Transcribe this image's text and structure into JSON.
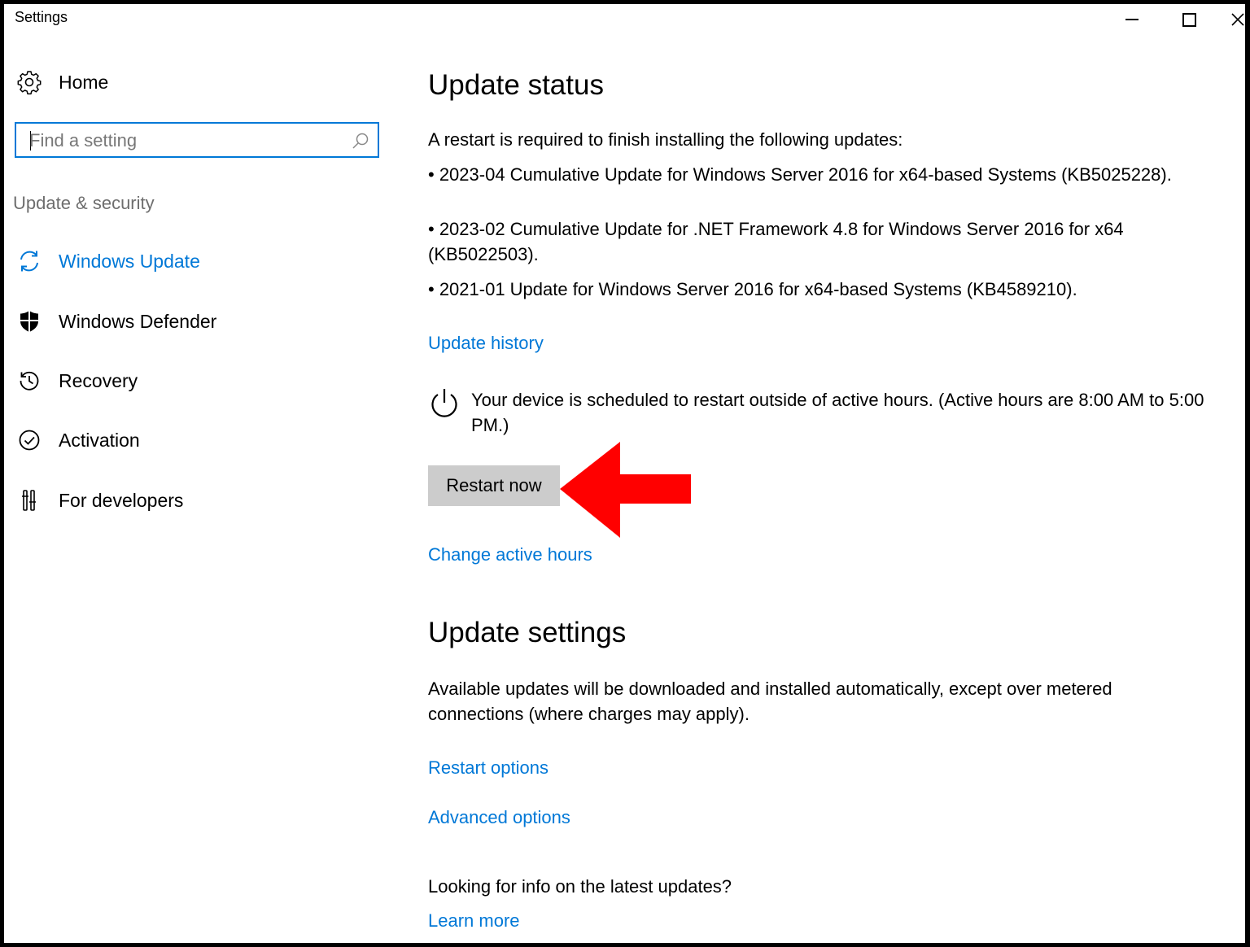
{
  "window": {
    "title": "Settings"
  },
  "sidebar": {
    "home_label": "Home",
    "search_placeholder": "Find a setting",
    "section_label": "Update & security",
    "items": [
      {
        "label": "Windows Update",
        "icon": "sync-icon",
        "active": true
      },
      {
        "label": "Windows Defender",
        "icon": "shield-icon",
        "active": false
      },
      {
        "label": "Recovery",
        "icon": "history-icon",
        "active": false
      },
      {
        "label": "Activation",
        "icon": "check-circle-icon",
        "active": false
      },
      {
        "label": "For developers",
        "icon": "developer-tools-icon",
        "active": false
      }
    ]
  },
  "main": {
    "update_status": {
      "heading": "Update status",
      "intro": "A restart is required to finish installing the following updates:",
      "updates": [
        {
          "line1": "• 2023-04 Cumulative Update for Windows Server 2016 for x64-based Systems (KB5025228)."
        },
        {
          "line1": "• 2023-02 Cumulative Update for .NET Framework 4.8 for Windows Server 2016 for x64",
          "line2": "(KB5022503)."
        },
        {
          "line1": "• 2021-01 Update for Windows Server 2016 for x64-based Systems (KB4589210)."
        }
      ],
      "history_link": "Update history",
      "schedule_text": "Your device is scheduled to restart outside of active hours. (Active hours are 8:00 AM to 5:00 PM.)",
      "restart_button": "Restart now",
      "active_hours_link": "Change active hours"
    },
    "update_settings": {
      "heading": "Update settings",
      "desc_line1": "Available updates will be downloaded and installed automatically, except over metered",
      "desc_line2": "connections (where charges may apply).",
      "restart_options_link": "Restart options",
      "advanced_options_link": "Advanced options",
      "info_question": "Looking for info on the latest updates?",
      "learn_more_link": "Learn more"
    }
  },
  "colors": {
    "accent": "#0078d7",
    "button_bg": "#cccccc",
    "annotation_arrow": "#ff0000",
    "muted_text": "#6e6e6e"
  }
}
